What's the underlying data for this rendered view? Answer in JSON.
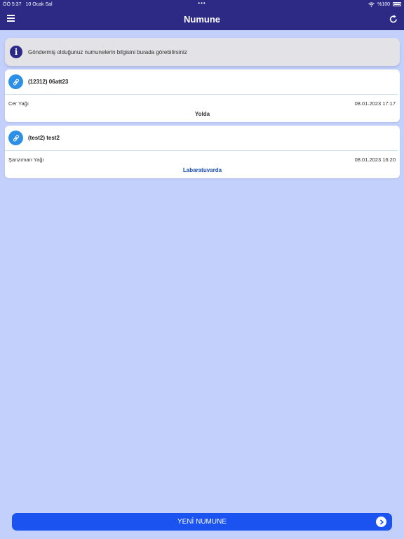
{
  "status_bar": {
    "time": "ÖÖ 5:37",
    "date": "10 Ocak Sal",
    "dots": "•••",
    "battery": "%100"
  },
  "header": {
    "title": "Numune",
    "menu_icon": "hamburger-icon",
    "refresh_icon": "refresh-icon"
  },
  "info": {
    "icon": "info-icon",
    "text": "Göndermiş olduğunuz numunelerin bilgisini burada görebilirsiniz"
  },
  "samples": [
    {
      "title": "(12312) 06att23",
      "type": "Cer Yağı",
      "date": "08.01.2023 17:17",
      "status": "Yolda",
      "status_color": "#333333"
    },
    {
      "title": "(test2) test2",
      "type": "Şanzıman Yağı",
      "date": "08.01.2023 16:20",
      "status": "Labaratuvarda",
      "status_color": "#1d4fb0"
    }
  ],
  "footer": {
    "button_label": "YENİ NUMUNE"
  },
  "colors": {
    "header": "#2d2a86",
    "background": "#c2d0fb",
    "button": "#1a53f0",
    "link_icon": "#2e8fe6"
  }
}
